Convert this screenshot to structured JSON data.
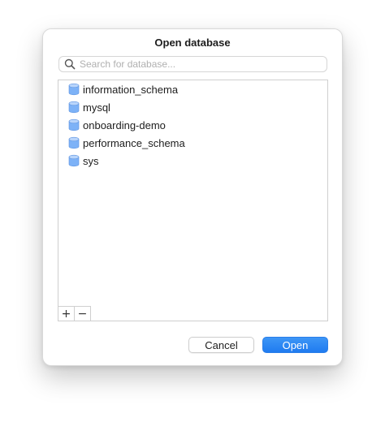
{
  "dialog": {
    "title": "Open database",
    "search": {
      "placeholder": "Search for database...",
      "value": ""
    },
    "databases": [
      {
        "label": "information_schema",
        "icon": "database-icon"
      },
      {
        "label": "mysql",
        "icon": "database-icon"
      },
      {
        "label": "onboarding-demo",
        "icon": "database-icon"
      },
      {
        "label": "performance_schema",
        "icon": "database-icon"
      },
      {
        "label": "sys",
        "icon": "database-icon"
      }
    ],
    "list_buttons": {
      "add_label": "+",
      "remove_label": "−"
    },
    "buttons": {
      "cancel_label": "Cancel",
      "open_label": "Open"
    }
  },
  "colors": {
    "accent": "#1f7bf0",
    "database_icon": "#6fa8f5"
  }
}
